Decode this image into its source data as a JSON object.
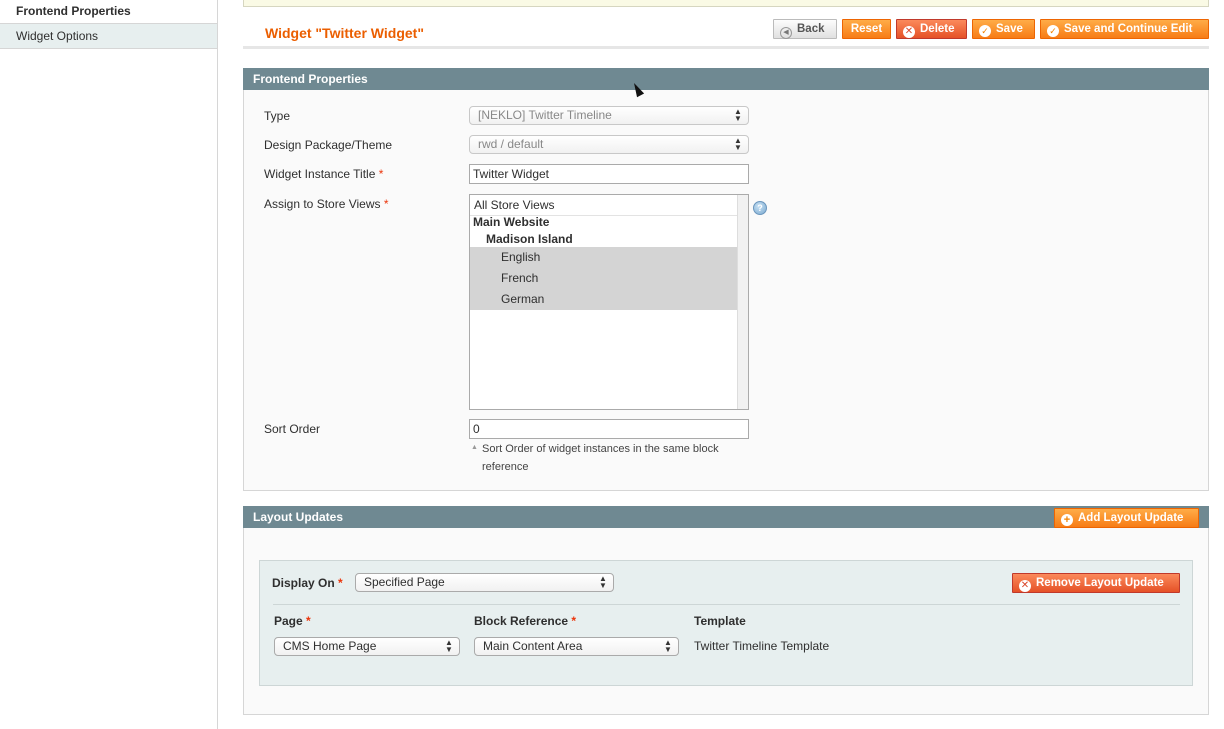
{
  "sidebar": {
    "tabs": [
      {
        "label": "Frontend Properties",
        "active": true
      },
      {
        "label": "Widget Options",
        "active": false
      }
    ]
  },
  "header": {
    "title": "Widget \"Twitter Widget\"",
    "buttons": {
      "back": "Back",
      "reset": "Reset",
      "delete": "Delete",
      "save": "Save",
      "save_continue": "Save and Continue Edit"
    }
  },
  "frontend": {
    "section_title": "Frontend Properties",
    "type": {
      "label": "Type",
      "value": "[NEKLO] Twitter Timeline"
    },
    "theme": {
      "label": "Design Package/Theme",
      "value": "rwd / default"
    },
    "title": {
      "label": "Widget Instance Title",
      "value": "Twitter Widget"
    },
    "store_views": {
      "label": "Assign to Store Views",
      "options": [
        {
          "label": "All Store Views",
          "level": 0,
          "selected": false,
          "group": false
        },
        {
          "label": "Main Website",
          "level": 0,
          "selected": false,
          "group": true
        },
        {
          "label": "Madison Island",
          "level": 1,
          "selected": false,
          "group": true
        },
        {
          "label": "English",
          "level": 2,
          "selected": true,
          "group": false
        },
        {
          "label": "French",
          "level": 2,
          "selected": true,
          "group": false
        },
        {
          "label": "German",
          "level": 2,
          "selected": true,
          "group": false
        }
      ]
    },
    "sort_order": {
      "label": "Sort Order",
      "value": "0",
      "note": "Sort Order of widget instances in the same block reference"
    },
    "help_icon": "question-icon"
  },
  "layout": {
    "section_title": "Layout Updates",
    "add_button": "Add Layout Update",
    "remove_button": "Remove Layout Update",
    "display_on": {
      "label": "Display On",
      "value": "Specified Page"
    },
    "page": {
      "label": "Page",
      "value": "CMS Home Page"
    },
    "block": {
      "label": "Block Reference",
      "value": "Main Content Area"
    },
    "template": {
      "label": "Template",
      "value": "Twitter Timeline Template"
    }
  },
  "colors": {
    "accent": "#eb5e00",
    "button_orange": "#f77c16",
    "section_header": "#6f8992",
    "required": "#eb340a"
  }
}
